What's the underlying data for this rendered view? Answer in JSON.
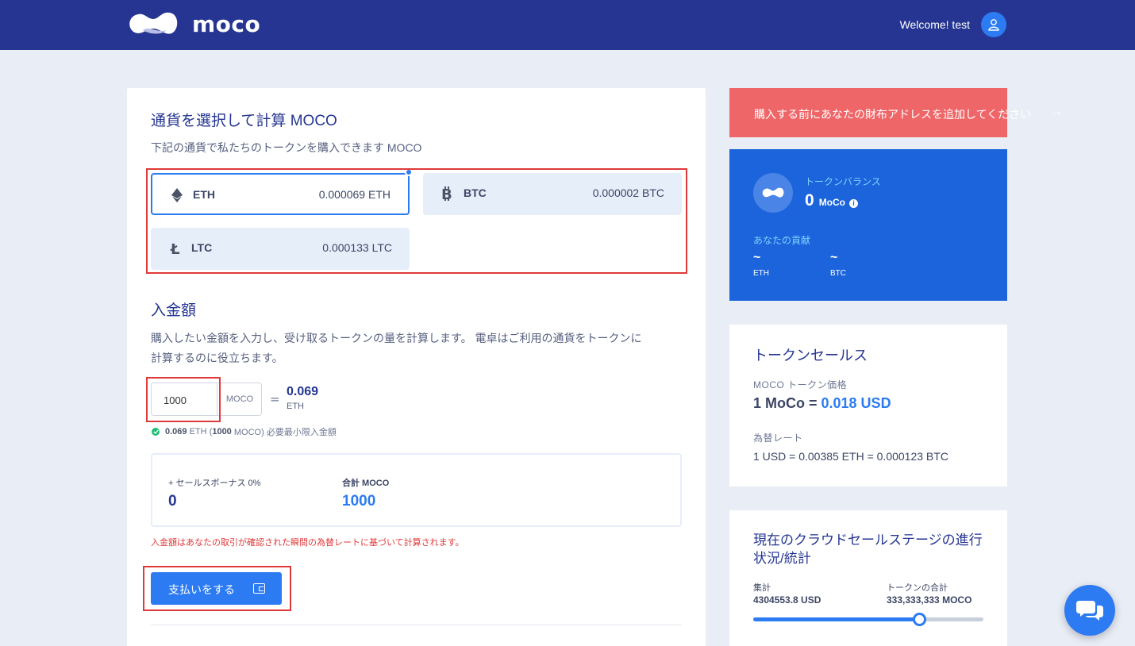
{
  "header": {
    "brand": "moco",
    "welcome": "Welcome! test"
  },
  "currency": {
    "title": "通貨を選択して計算 MOCO",
    "subtitle": "下記の通貨で私たちのトークンを購入できます MOCO",
    "coins": [
      {
        "name": "ETH",
        "value": "0.000069 ETH",
        "icon": "eth-icon",
        "selected": true
      },
      {
        "name": "BTC",
        "value": "0.000002 BTC",
        "icon": "btc-icon",
        "selected": false
      },
      {
        "name": "LTC",
        "value": "0.000133 LTC",
        "icon": "ltc-icon",
        "selected": false
      }
    ]
  },
  "amount": {
    "title": "入金額",
    "description_line1": "購入したい金額を入力し、受け取るトークンの量を計算します。 電卓はご利用の通貨をトークンに",
    "description_line2": "計算するのに役立ちます。",
    "input_value": "1000",
    "input_unit": "MOCO",
    "equals": "=",
    "result_value": "0.069",
    "result_currency": "ETH",
    "min_value": "0.069",
    "min_currency": "ETH (",
    "min_moco": "1000",
    "min_suffix": "MOCO) 必要最小限入金額"
  },
  "bonus": {
    "bonus_label": "+ セールスボーナス 0%",
    "bonus_value": "0",
    "total_label": "合計 MOCO",
    "total_value": "1000"
  },
  "notice": "入金額はあなたの取引が確認された瞬間の為替レートに基づいて計算されます。",
  "pay_button": "支払いをする",
  "alert": {
    "text": "購入する前にあなたの財布アドレスを追加してください",
    "arrow": "→"
  },
  "balance": {
    "label": "トークンバランス",
    "value": "0",
    "unit": "MoCo",
    "info": "i",
    "contribution_label": "あなたの貢献",
    "contributions": [
      {
        "value": "~",
        "currency": "ETH"
      },
      {
        "value": "~",
        "currency": "BTC"
      }
    ]
  },
  "sale": {
    "title": "トークンセールス",
    "price_label": "MOCO トークン価格",
    "price_prefix": "1 MoCo = ",
    "price_value": "0.018 USD",
    "rate_label": "為替レート",
    "rate_value": "1 USD = 0.00385 ETH = 0.000123 BTC"
  },
  "stage": {
    "title": "現在のクラウドセールステージの進行状況/統計",
    "raised_label": "集計",
    "raised_value": "4304553.8 USD",
    "total_label": "トークンの合計",
    "total_value": "333,333,333 MOCO",
    "progress_fraction": 0.72
  },
  "colors": {
    "header": "#253591",
    "accent": "#2c7bf2",
    "alert": "#ef6668",
    "highlight_box": "#e0393a"
  }
}
